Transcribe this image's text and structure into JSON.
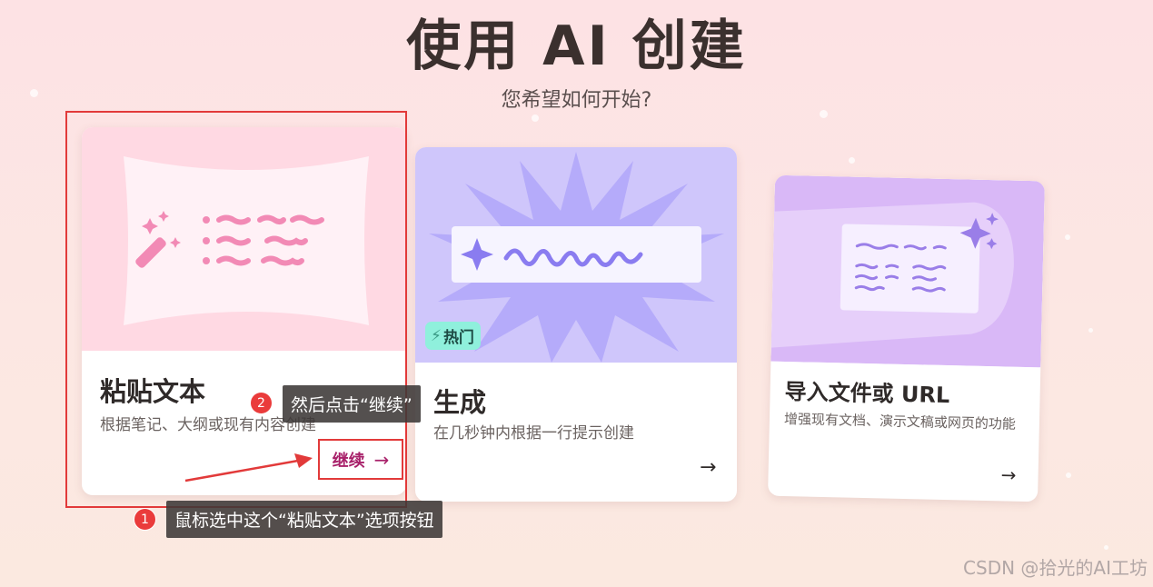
{
  "header": {
    "title": "使用 AI 创建",
    "subtitle": "您希望如何开始?"
  },
  "cards": [
    {
      "title": "粘贴文本",
      "description": "根据笔记、大纲或现有内容创建",
      "action_label": "继续",
      "action_arrow": "→",
      "art_icon": "magic-wand-icon"
    },
    {
      "title": "生成",
      "description": "在几秒钟内根据一行提示创建",
      "badge": "热门",
      "badge_icon": "lightning-icon",
      "action_arrow": "→",
      "art_icon": "sparkle-icon"
    },
    {
      "title": "导入文件或 URL",
      "description": "增强现有文档、演示文稿或网页的功能",
      "action_arrow": "→",
      "art_icon": "sparkle-icon"
    }
  ],
  "annotations": {
    "step1_number": "1",
    "step1_text": "鼠标选中这个“粘贴文本”选项按钮",
    "step2_number": "2",
    "step2_text": "然后点击“继续”",
    "highlight_color": "#e23a3a"
  },
  "watermark": "CSDN @拾光的AI工坊",
  "colors": {
    "accent": "#a8216a",
    "badge_bg": "#8ff0dc",
    "card1_art": "#ffd9e3",
    "card2_art": "#cfc6fb",
    "card3_art": "#d9b8f7"
  }
}
